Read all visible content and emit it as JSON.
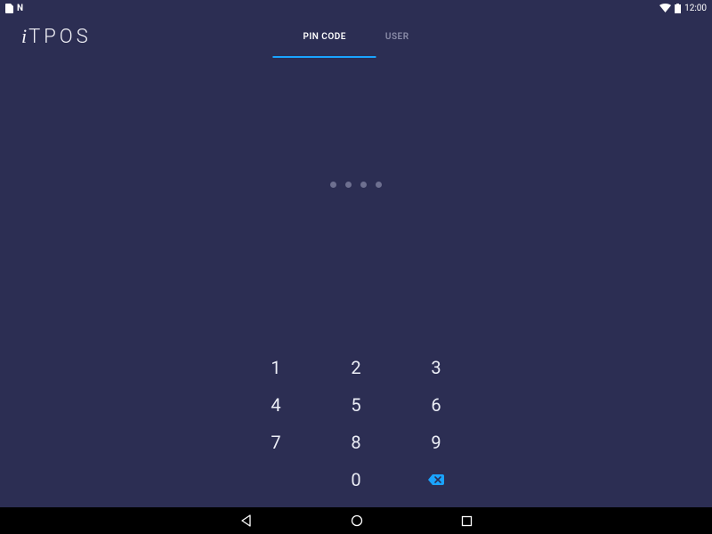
{
  "status_bar": {
    "time": "12:00"
  },
  "logo": {
    "prefix": "i",
    "rest": "TPOS"
  },
  "tabs": {
    "pin_code": "PIN CODE",
    "user": "USER"
  },
  "pin": {
    "length": 4,
    "entered": 0
  },
  "keypad": {
    "k1": "1",
    "k2": "2",
    "k3": "3",
    "k4": "4",
    "k5": "5",
    "k6": "6",
    "k7": "7",
    "k8": "8",
    "k9": "9",
    "k0": "0"
  }
}
